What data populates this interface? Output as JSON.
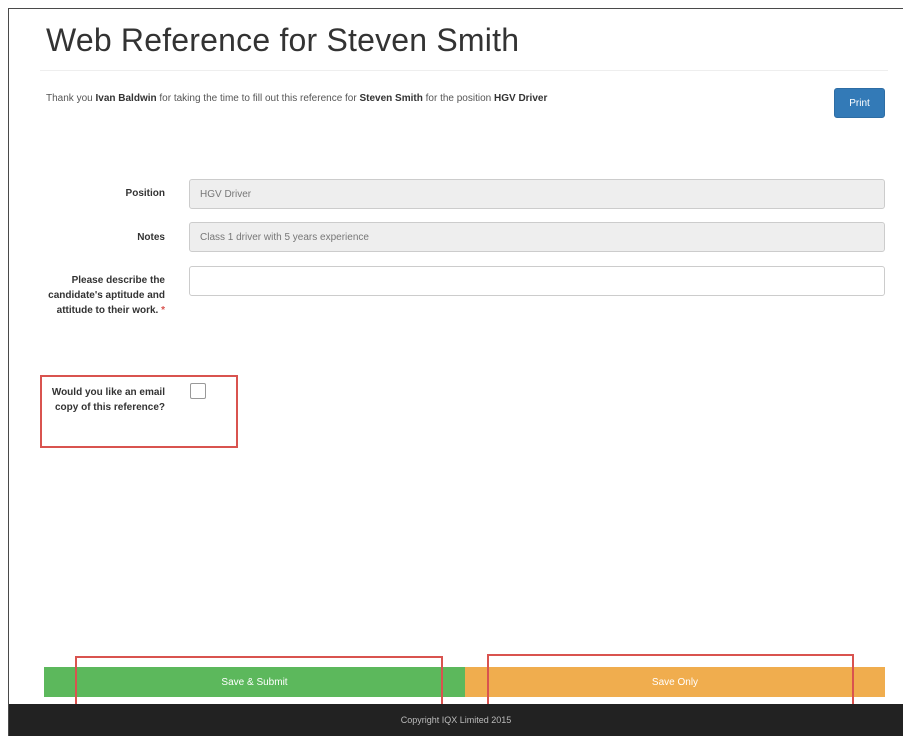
{
  "page": {
    "title": "Web Reference for Steven Smith"
  },
  "intro": {
    "t1": "Thank you ",
    "referee": "Ivan Baldwin",
    "t2": " for taking the time to fill out this reference for ",
    "candidate": "Steven Smith",
    "t3": " for the position ",
    "position": "HGV Driver"
  },
  "toolbar": {
    "print_label": "Print"
  },
  "form": {
    "position_label": "Position",
    "position_value": "HGV Driver",
    "notes_label": "Notes",
    "notes_value": "Class 1 driver with 5 years experience",
    "aptitude_label": "Please describe the candidate's aptitude and attitude to their work.",
    "aptitude_required_marker": "*",
    "aptitude_value": "",
    "email_copy_label": "Would you like an email copy of this reference?",
    "email_copy_checked": false
  },
  "actions": {
    "submit_label": "Save & Submit",
    "save_label": "Save Only"
  },
  "footer": {
    "copyright": "Copyright IQX Limited 2015"
  },
  "colors": {
    "primary": "#337ab7",
    "success": "#5cb85c",
    "warning": "#f0ad4e",
    "highlight": "#d9534f",
    "footer_bg": "#222222"
  }
}
